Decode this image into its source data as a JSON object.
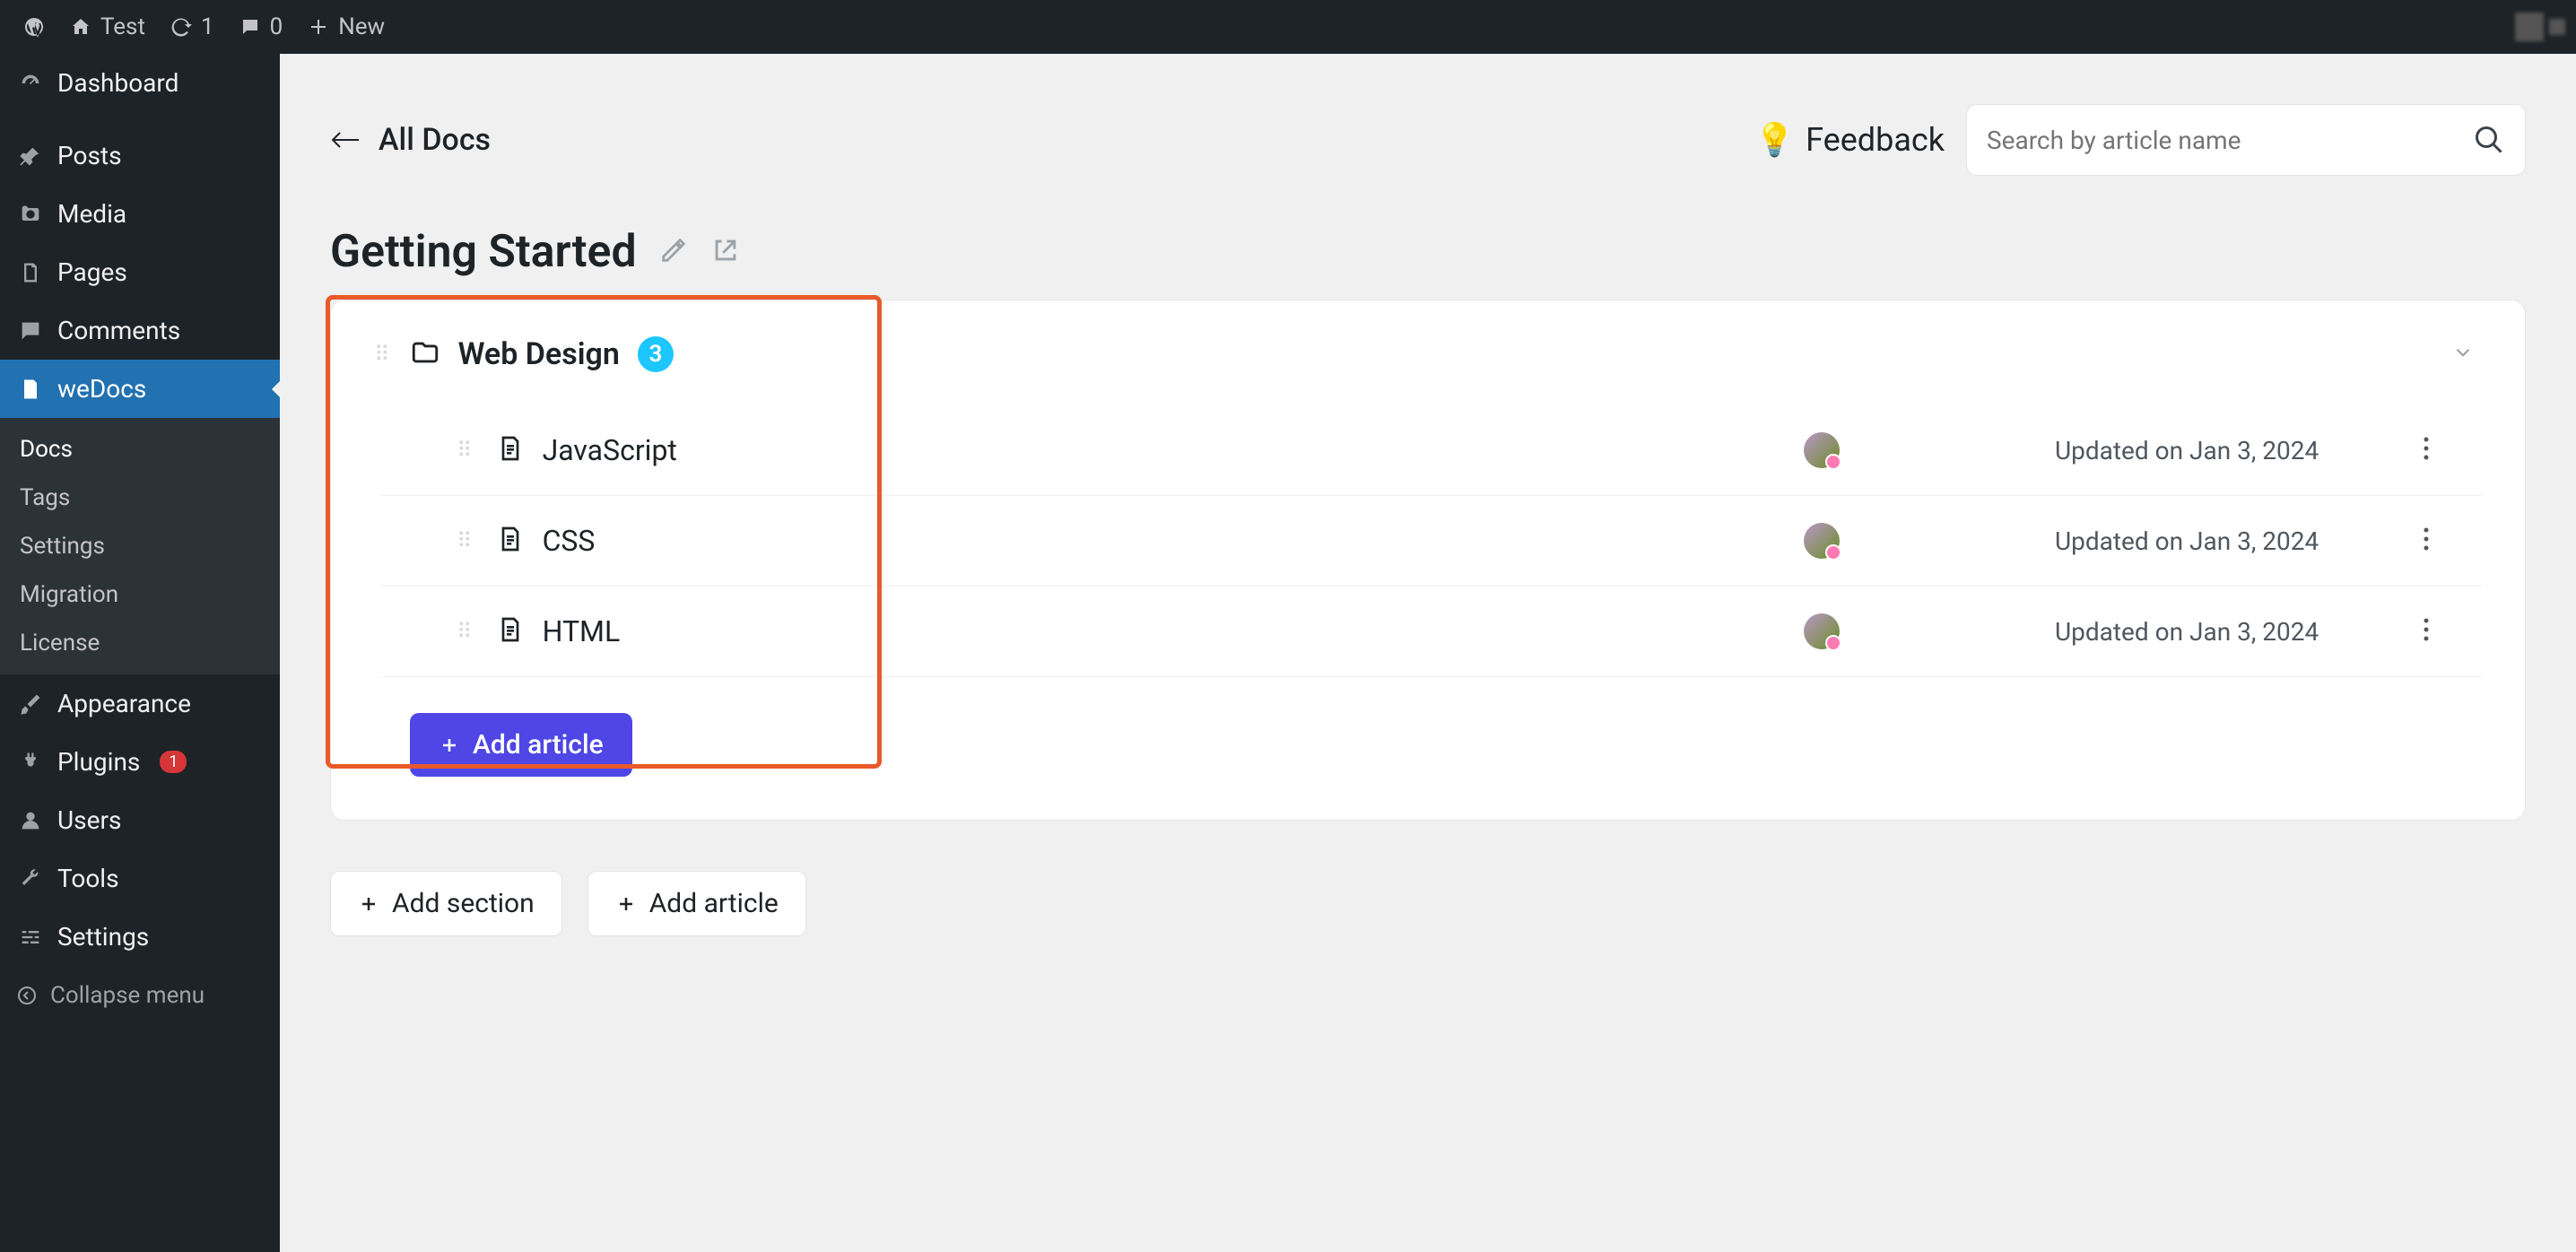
{
  "adminbar": {
    "site_name": "Test",
    "updates_count": "1",
    "comments_count": "0",
    "new_label": "New"
  },
  "sidebar": {
    "items": [
      {
        "label": "Dashboard"
      },
      {
        "label": "Posts"
      },
      {
        "label": "Media"
      },
      {
        "label": "Pages"
      },
      {
        "label": "Comments"
      },
      {
        "label": "weDocs"
      },
      {
        "label": "Appearance"
      },
      {
        "label": "Plugins"
      },
      {
        "label": "Users"
      },
      {
        "label": "Tools"
      },
      {
        "label": "Settings"
      }
    ],
    "plugins_badge": "1",
    "submenu": [
      {
        "label": "Docs"
      },
      {
        "label": "Tags"
      },
      {
        "label": "Settings"
      },
      {
        "label": "Migration"
      },
      {
        "label": "License"
      }
    ],
    "collapse_label": "Collapse menu"
  },
  "header": {
    "back_label": "All Docs",
    "feedback_label": "Feedback",
    "feedback_emoji": "💡",
    "search_placeholder": "Search by article name"
  },
  "page": {
    "title": "Getting Started"
  },
  "section": {
    "name": "Web Design",
    "count": "3",
    "articles": [
      {
        "name": "JavaScript",
        "updated": "Updated on Jan 3, 2024"
      },
      {
        "name": "CSS",
        "updated": "Updated on Jan 3, 2024"
      },
      {
        "name": "HTML",
        "updated": "Updated on Jan 3, 2024"
      }
    ]
  },
  "actions": {
    "add_article": "Add article",
    "add_section": "Add section"
  }
}
